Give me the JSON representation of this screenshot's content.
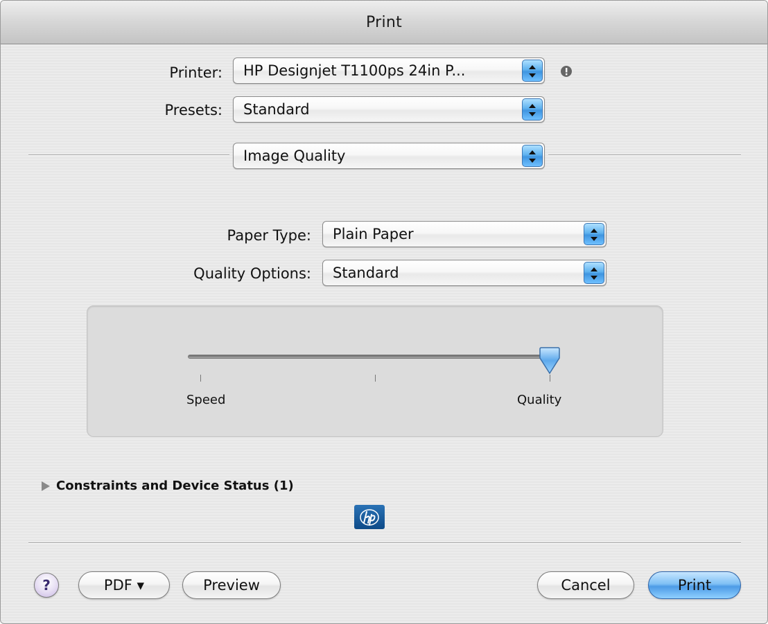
{
  "window": {
    "title": "Print"
  },
  "printer": {
    "label": "Printer:",
    "value": "HP Designjet T1100ps 24in P..."
  },
  "presets": {
    "label": "Presets:",
    "value": "Standard"
  },
  "panel": {
    "value": "Image Quality"
  },
  "paper_type": {
    "label": "Paper Type:",
    "value": "Plain Paper"
  },
  "quality_options": {
    "label": "Quality Options:",
    "value": "Standard"
  },
  "slider": {
    "min_label": "Speed",
    "max_label": "Quality",
    "value": 1.0,
    "ticks": 3
  },
  "disclosure": {
    "label": "Constraints and Device Status (1)"
  },
  "buttons": {
    "help": "?",
    "pdf": "PDF ▾",
    "preview": "Preview",
    "cancel": "Cancel",
    "print": "Print"
  },
  "colors": {
    "accent": "#4d9be6",
    "logo": "#0d4a88"
  }
}
